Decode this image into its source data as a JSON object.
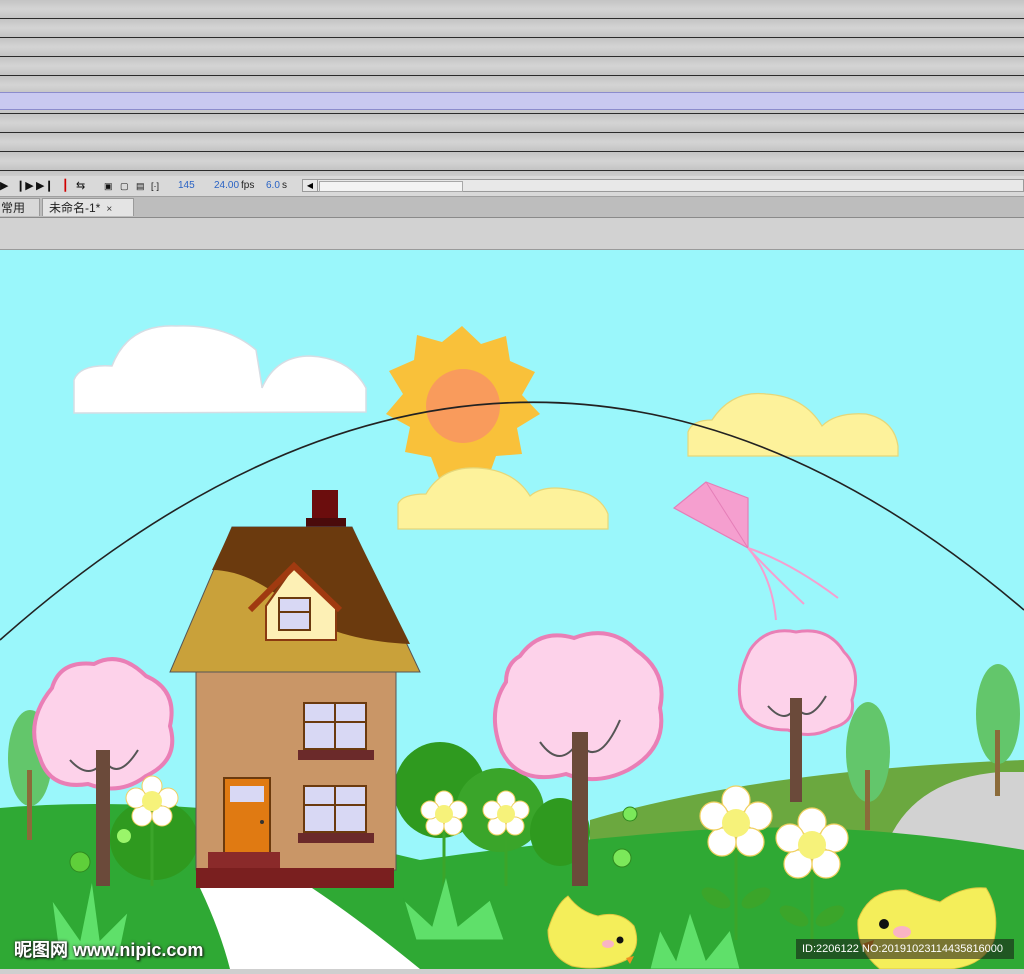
{
  "timeline": {
    "frame_number": "145",
    "fps_value": "24.00",
    "fps_unit": "fps",
    "time_value": "6.0",
    "time_unit": "s"
  },
  "tabs": [
    {
      "label": "常用",
      "close": "×"
    },
    {
      "label": "未命名-1*",
      "close": "×"
    }
  ],
  "watermark": {
    "left": "昵图网 www.nipic.com",
    "right": "ID:2206122 NO:20191023114435816000"
  },
  "colors": {
    "sky": "#9af7fb",
    "sun": "#f9c13a",
    "sun_core": "#f99b5c",
    "cloud_yellow": "#fdf29b",
    "tree_blossom": "#fdd2ea",
    "grass": "#2fa934",
    "hill": "#6ba83f",
    "house_wall": "#c99667",
    "roof": "#6b3a0e",
    "chick": "#f4ee5a"
  },
  "icons": [
    "play-icon",
    "step-forward-icon",
    "go-to-end-icon",
    "onion-skin-icon",
    "loop-icon",
    "edit-multiple-frames-icon"
  ]
}
